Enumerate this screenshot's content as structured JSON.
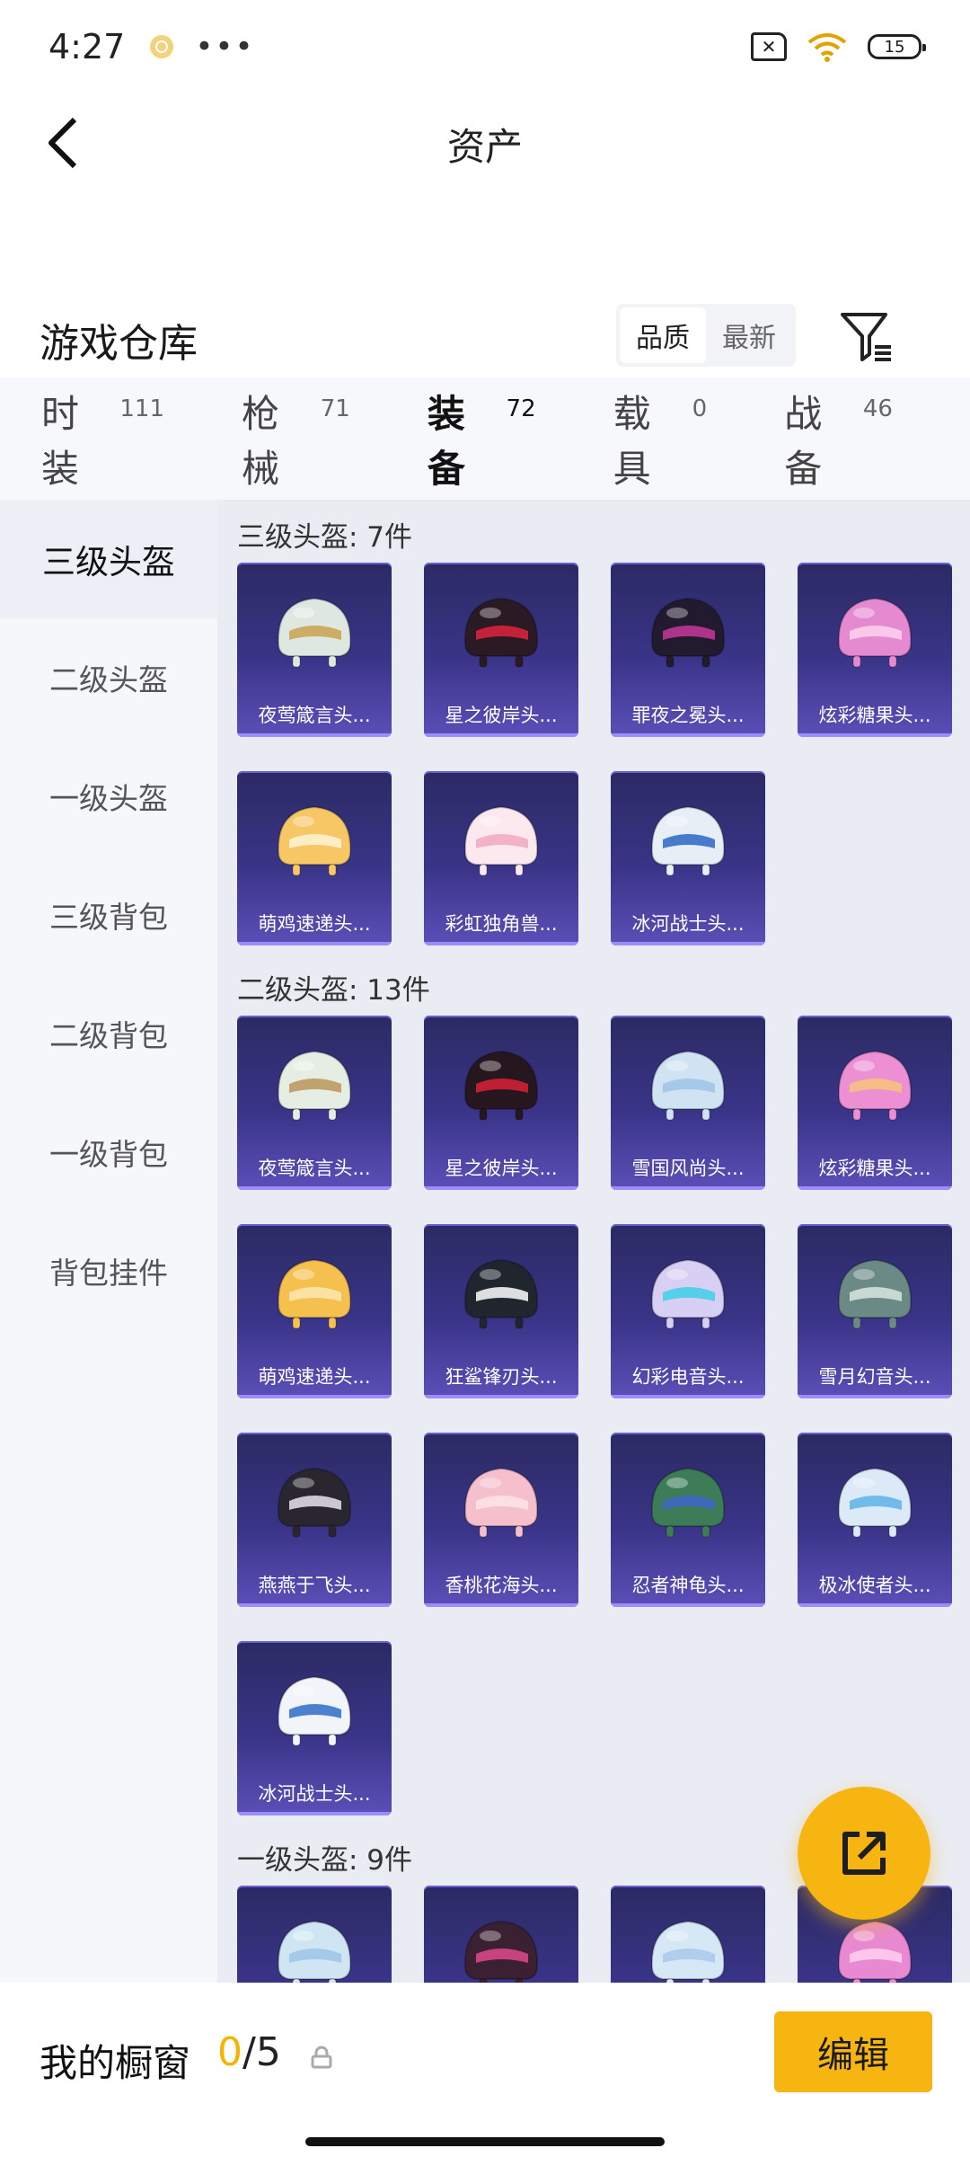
{
  "status_bar": {
    "time": "4:27",
    "more": "•••",
    "battery": "15"
  },
  "header": {
    "title": "资产"
  },
  "warehouse": {
    "title": "游戏仓库",
    "sort_options": [
      "品质",
      "最新"
    ],
    "sort_active": 0
  },
  "tabs": [
    {
      "label": "时装",
      "count": "111"
    },
    {
      "label": "枪械",
      "count": "71"
    },
    {
      "label": "装备",
      "count": "72"
    },
    {
      "label": "载具",
      "count": "0"
    },
    {
      "label": "战备",
      "count": "46"
    }
  ],
  "active_tab": 2,
  "sidebar": [
    {
      "label": "三级头盔"
    },
    {
      "label": "二级头盔"
    },
    {
      "label": "一级头盔"
    },
    {
      "label": "三级背包"
    },
    {
      "label": "二级背包"
    },
    {
      "label": "一级背包"
    },
    {
      "label": "背包挂件"
    }
  ],
  "sections": [
    {
      "title": "三级头盔: 7件",
      "items": [
        {
          "name": "夜莺箴言头...",
          "color": "#dfe8e0",
          "accent": "#c9a24e"
        },
        {
          "name": "星之彼岸头...",
          "color": "#2a1a24",
          "accent": "#e0233c"
        },
        {
          "name": "罪夜之冕头...",
          "color": "#221a2e",
          "accent": "#c7389b"
        },
        {
          "name": "炫彩糖果头...",
          "color": "#e58ad0",
          "accent": "#ffd1f0"
        },
        {
          "name": "萌鸡速递头...",
          "color": "#f7c766",
          "accent": "#fff3d6"
        },
        {
          "name": "彩虹独角兽...",
          "color": "#fbe9ef",
          "accent": "#f2a7c3"
        },
        {
          "name": "冰河战士头...",
          "color": "#e8eef6",
          "accent": "#2d66c5"
        }
      ]
    },
    {
      "title": "二级头盔: 13件",
      "items": [
        {
          "name": "夜莺箴言头...",
          "color": "#e6eee4",
          "accent": "#b8955a"
        },
        {
          "name": "星之彼岸头...",
          "color": "#26161e",
          "accent": "#d92136"
        },
        {
          "name": "雪国风尚头...",
          "color": "#cfe3f3",
          "accent": "#9fc3e6"
        },
        {
          "name": "炫彩糖果头...",
          "color": "#ec8fd3",
          "accent": "#f7c47a"
        },
        {
          "name": "萌鸡速递头...",
          "color": "#f6c04f",
          "accent": "#fde7b0"
        },
        {
          "name": "狂鲨锋刃头...",
          "color": "#20252e",
          "accent": "#ffffff"
        },
        {
          "name": "幻彩电音头...",
          "color": "#d8d0f4",
          "accent": "#3fd0e6"
        },
        {
          "name": "雪月幻音头...",
          "color": "#6b8a86",
          "accent": "#d8e6e0"
        },
        {
          "name": "燕燕于飞头...",
          "color": "#2a2630",
          "accent": "#e8e3ef"
        },
        {
          "name": "香桃花海头...",
          "color": "#f5bfcc",
          "accent": "#fde3e9"
        },
        {
          "name": "忍者神龟头...",
          "color": "#3c7d57",
          "accent": "#3d64c9"
        },
        {
          "name": "极冰使者头...",
          "color": "#dbeaf6",
          "accent": "#5db3e6"
        },
        {
          "name": "冰河战士头...",
          "color": "#f1f4f8",
          "accent": "#2f6cc9"
        }
      ]
    },
    {
      "title": "一级头盔: 9件",
      "items": [
        {
          "name": "",
          "color": "#cfe5f3",
          "accent": "#9ec5e6"
        },
        {
          "name": "",
          "color": "#3a2030",
          "accent": "#e04a8c"
        },
        {
          "name": "",
          "color": "#d6e8f6",
          "accent": "#a8c8ea"
        },
        {
          "name": "",
          "color": "#e889d2",
          "accent": "#ffd0ef"
        }
      ]
    }
  ],
  "bottom_bar": {
    "label": "我的橱窗",
    "current": "0",
    "sep_total": "/5",
    "edit_label": "编辑"
  }
}
